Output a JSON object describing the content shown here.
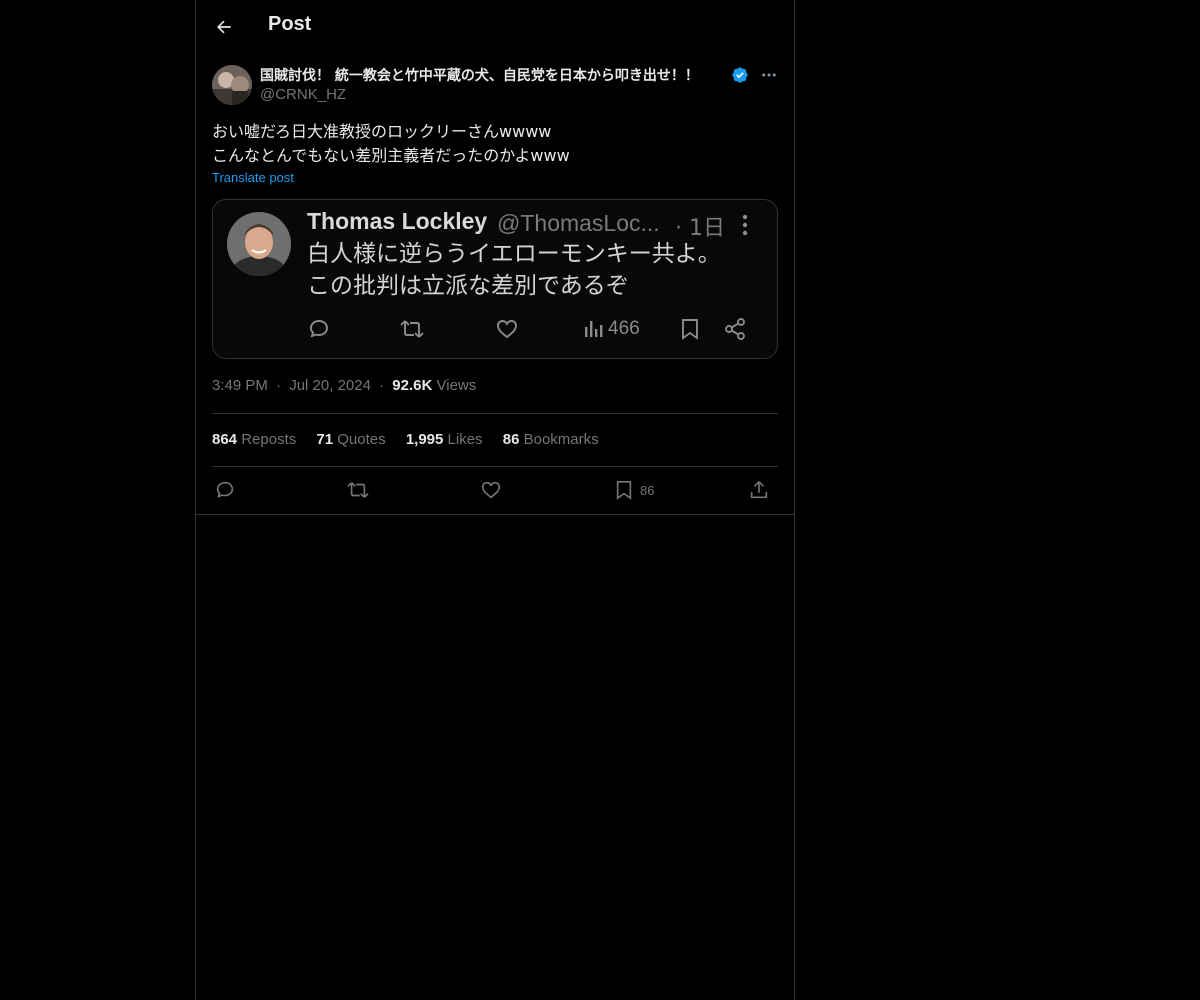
{
  "header": {
    "title": "Post"
  },
  "author": {
    "display_name": "国賊討伐！ 統一教会と竹中平蔵の犬、自民党を日本から叩き出せ！！",
    "handle": "@CRNK_HZ",
    "verified": true
  },
  "post": {
    "text": "おい嘘だろ日大准教授のロックリーさんwwww\nこんなとんでもない差別主義者だったのかよwww",
    "translate_label": "Translate post"
  },
  "embedded_screenshot": {
    "name": "Thomas Lockley",
    "handle": "@ThomasLoc...",
    "time": "· 1日",
    "text": "白人様に逆らうイエローモンキー共よ。\nこの批判は立派な差別であるぞ",
    "views": "466"
  },
  "meta": {
    "time": "3:49 PM",
    "sep1": "·",
    "date": "Jul 20, 2024",
    "sep2": "·",
    "views_count": "92.6K",
    "views_label": "Views"
  },
  "stats": {
    "reposts_count": "864",
    "reposts_label": "Reposts",
    "quotes_count": "71",
    "quotes_label": "Quotes",
    "likes_count": "1,995",
    "likes_label": "Likes",
    "bookmarks_count": "86",
    "bookmarks_label": "Bookmarks"
  },
  "actions": {
    "bookmark_count": "86"
  },
  "colors": {
    "accent": "#1d9bf0",
    "background": "#000000",
    "text": "#e7e9ea",
    "muted": "#71767b",
    "border": "#2f3336"
  }
}
